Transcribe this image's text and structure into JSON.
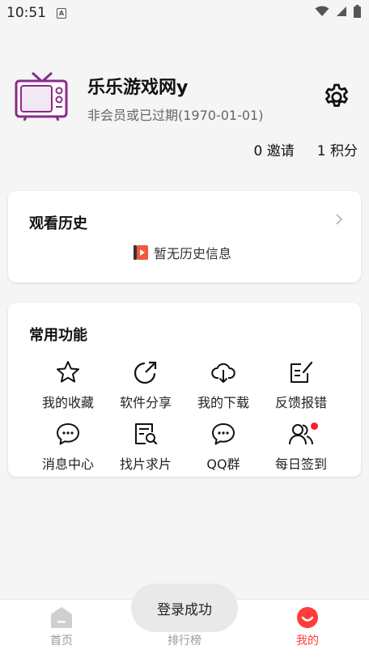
{
  "status_bar": {
    "time": "10:51",
    "notification_icon": "A"
  },
  "profile": {
    "username": "乐乐游戏网y",
    "membership": "非会员或已过期(1970-01-01)",
    "invites": "0 邀请",
    "points": "1 积分"
  },
  "history": {
    "title": "观看历史",
    "empty_text": "暂无历史信息"
  },
  "functions": {
    "title": "常用功能",
    "items": [
      {
        "label": "我的收藏",
        "icon": "star-icon"
      },
      {
        "label": "软件分享",
        "icon": "share-icon"
      },
      {
        "label": "我的下载",
        "icon": "cloud-download-icon"
      },
      {
        "label": "反馈报错",
        "icon": "edit-note-icon"
      },
      {
        "label": "消息中心",
        "icon": "message-icon"
      },
      {
        "label": "找片求片",
        "icon": "search-doc-icon"
      },
      {
        "label": "QQ群",
        "icon": "chat-bubble-icon"
      },
      {
        "label": "每日签到",
        "icon": "users-icon"
      }
    ]
  },
  "bottom_nav": {
    "items": [
      {
        "label": "首页",
        "icon": "home-icon",
        "active": false
      },
      {
        "label": "排行榜",
        "icon": "rank-icon",
        "active": false
      },
      {
        "label": "我的",
        "icon": "smile-icon",
        "active": true
      }
    ]
  },
  "toast": "登录成功",
  "colors": {
    "accent": "#ff3b3b",
    "badge": "#ff1b2a",
    "avatar_purple": "#8a2b8a"
  }
}
